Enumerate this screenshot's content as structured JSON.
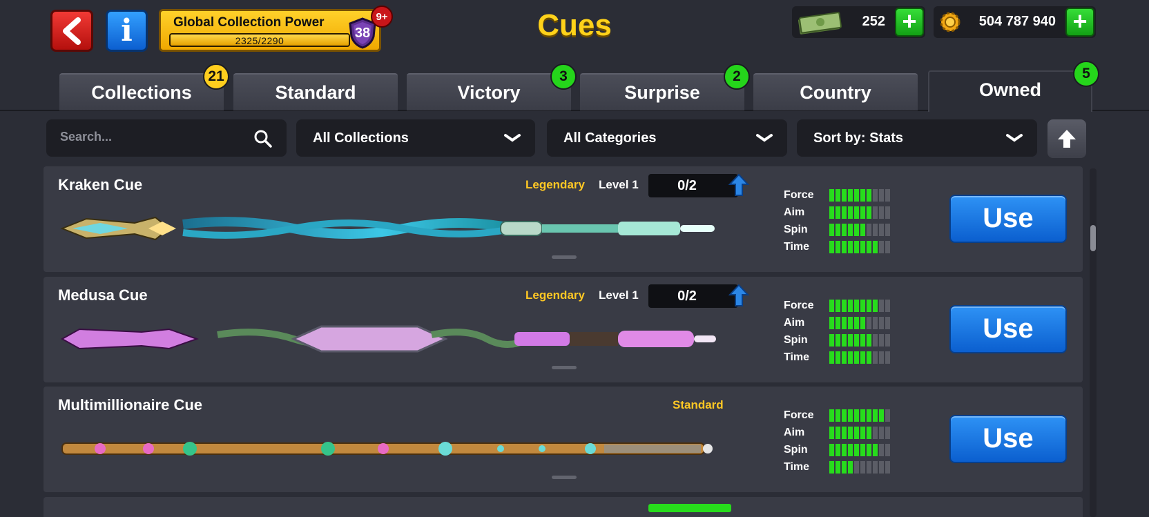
{
  "header": {
    "title": "Cues",
    "back_icon": "back-arrow-icon",
    "info_icon": "info-icon",
    "collection_power": {
      "label": "Global Collection Power",
      "progress_text": "2325/2290",
      "progress_fraction": 1.0,
      "level": "38",
      "notification_badge": "9+"
    },
    "cash": {
      "icon": "cash-icon",
      "value": "252",
      "add_icon": "plus-icon"
    },
    "coins": {
      "icon": "coin-icon",
      "value": "504 787 940",
      "add_icon": "plus-icon"
    }
  },
  "tabs": [
    {
      "label": "Collections",
      "badge": "21",
      "badge_color": "#ffce1e",
      "active": false
    },
    {
      "label": "Standard",
      "badge": "",
      "active": false
    },
    {
      "label": "Victory",
      "badge": "3",
      "badge_color": "#25d51b",
      "active": false
    },
    {
      "label": "Surprise",
      "badge": "2",
      "badge_color": "#25d51b",
      "active": false
    },
    {
      "label": "Country",
      "badge": "",
      "active": false
    },
    {
      "label": "Owned",
      "badge": "5",
      "badge_color": "#25d51b",
      "active": true
    }
  ],
  "filters": {
    "search_placeholder": "Search...",
    "collections": "All Collections",
    "categories": "All Categories",
    "sort": "Sort by: Stats",
    "sort_direction_icon": "arrow-up-icon"
  },
  "stat_labels": [
    "Force",
    "Aim",
    "Spin",
    "Time"
  ],
  "stat_max": 10,
  "cues": [
    {
      "name": "Kraken Cue",
      "rarity": "Legendary",
      "level": "Level 1",
      "pieces": "0/2",
      "stats": {
        "Force": 7,
        "Aim": 7,
        "Spin": 6,
        "Time": 8
      },
      "use_label": "Use"
    },
    {
      "name": "Medusa Cue",
      "rarity": "Legendary",
      "level": "Level 1",
      "pieces": "0/2",
      "stats": {
        "Force": 8,
        "Aim": 6,
        "Spin": 7,
        "Time": 7
      },
      "use_label": "Use"
    },
    {
      "name": "Multimillionaire Cue",
      "rarity": "Standard",
      "level": "",
      "pieces": "",
      "stats": {
        "Force": 9,
        "Aim": 7,
        "Spin": 8,
        "Time": 4
      },
      "use_label": "Use"
    }
  ],
  "colors": {
    "accent_yellow": "#ffd21a",
    "use_blue": "#1a78e6",
    "stat_green": "#27dc1c",
    "back_red": "#d8221e"
  }
}
